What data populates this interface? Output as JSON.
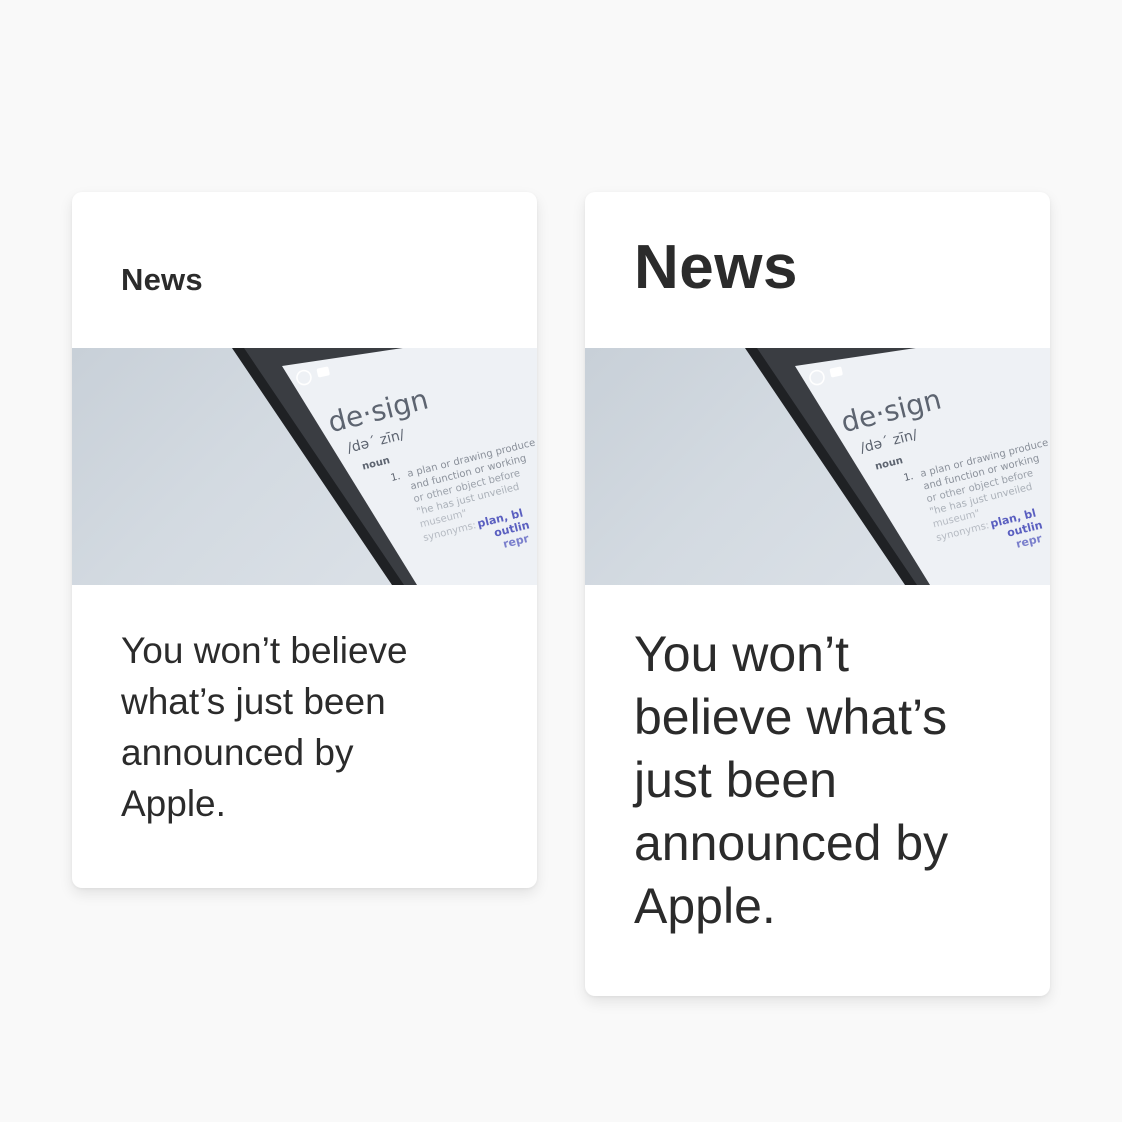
{
  "cards": [
    {
      "variant": "small-heading",
      "title": "News",
      "body": "You won’t believe what’s just been announced by Apple.",
      "image": {
        "word": "de·sign",
        "pronunciation": "/də΄ zīn/",
        "part_of_speech": "noun",
        "number": "1.",
        "definition_lines": [
          "a plan or drawing produce",
          "and function or working",
          "or other object before",
          "\"he has just unveiled",
          "museum\""
        ],
        "synonyms_label": "synonyms:",
        "synonyms": [
          "plan, bl",
          "outlin",
          "repr"
        ]
      }
    },
    {
      "variant": "large-heading",
      "title": "News",
      "body": "You won’t believe what’s just been announced by Apple.",
      "image": {
        "word": "de·sign",
        "pronunciation": "/də΄ zīn/",
        "part_of_speech": "noun",
        "number": "1.",
        "definition_lines": [
          "a plan or drawing produce",
          "and function or working",
          "or other object before",
          "\"he has just unveiled",
          "museum\""
        ],
        "synonyms_label": "synonyms:",
        "synonyms": [
          "plan, bl",
          "outlin",
          "repr"
        ]
      }
    }
  ],
  "colors": {
    "background": "#f9f9f9",
    "card": "#ffffff",
    "text": "#2b2b2b",
    "photo_bg": "#d3dae1",
    "phone_body": "#2a2c2f",
    "screen": "#eef1f5",
    "synonym_link": "#5a5fc0"
  },
  "icons": [
    "whatsapp-icon",
    "message-icon"
  ]
}
